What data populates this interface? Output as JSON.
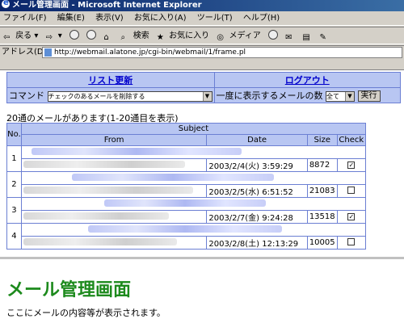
{
  "window": {
    "title": "メール管理画面 - Microsoft Internet Explorer"
  },
  "menu": [
    "ファイル(F)",
    "編集(E)",
    "表示(V)",
    "お気に入り(A)",
    "ツール(T)",
    "ヘルプ(H)"
  ],
  "toolbar": {
    "back": "戻る",
    "search": "検索",
    "favorites": "お気に入り",
    "media": "メディア"
  },
  "address": {
    "label": "アドレス(D)",
    "url": "http://webmail.alatone.jp/cgi-bin/webmail/1/frame.pl"
  },
  "controls": {
    "refresh_link": "リスト更新",
    "logout_link": "ログアウト",
    "command_label": "コマンド",
    "command_selected": "チェックのあるメールを削除する",
    "per_page_label": "一度に表示するメールの数",
    "per_page_selected": "全て",
    "execute_button": "実行"
  },
  "mail_count_text": "20通のメールがあります(1-20通目を表示)",
  "table": {
    "headers": {
      "no": "No.",
      "subject": "Subject",
      "from": "From",
      "date": "Date",
      "size": "Size",
      "check": "Check"
    },
    "rows": [
      {
        "no": "1",
        "date": "2003/2/4(火) 3:59:29",
        "size": "8872",
        "checked": true
      },
      {
        "no": "2",
        "date": "2003/2/5(水) 6:51:52",
        "size": "21083",
        "checked": false
      },
      {
        "no": "3",
        "date": "2003/2/7(金) 9:24:28",
        "size": "13518",
        "checked": true
      },
      {
        "no": "4",
        "date": "2003/2/8(土) 12:13:29",
        "size": "10005",
        "checked": false
      }
    ]
  },
  "bottom": {
    "heading": "メール管理画面",
    "body": "ここにメールの内容等が表示されます。"
  }
}
